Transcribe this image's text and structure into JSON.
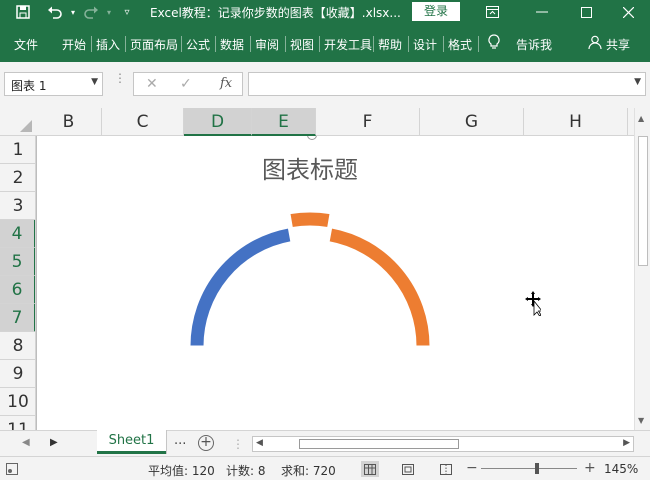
{
  "window": {
    "title": "Excel教程：记录你步数的图表【收藏】.xlsx...",
    "login_label": "登录"
  },
  "ribbon": {
    "tabs": [
      "文件",
      "开始",
      "插入",
      "页面布局",
      "公式",
      "数据",
      "审阅",
      "视图",
      "开发工具",
      "帮助",
      "设计",
      "格式"
    ],
    "tell_me": "告诉我",
    "share": "共享"
  },
  "formula_bar": {
    "name_box": "图表 1",
    "fx": "fx",
    "formula": ""
  },
  "columns": [
    "B",
    "C",
    "D",
    "E",
    "F",
    "G",
    "H"
  ],
  "selected_columns": [
    "D",
    "E"
  ],
  "rows": [
    "1",
    "2",
    "3",
    "4",
    "5",
    "6",
    "7",
    "8",
    "9",
    "10",
    "11"
  ],
  "selected_rows": [
    "4",
    "5",
    "6",
    "7"
  ],
  "chart_data": {
    "type": "pie",
    "title": "图表标题",
    "style": "half-doughnut",
    "categories": [
      "",
      "",
      ""
    ],
    "values": [
      40,
      10,
      40
    ],
    "exploded": [
      false,
      true,
      false
    ],
    "colors": [
      "#4472C4",
      "#ED7D31",
      "#ED7D31"
    ],
    "start_angle_deg": 180,
    "end_angle_deg": 360
  },
  "sheet": {
    "tab": "Sheet1",
    "more": "..."
  },
  "status": {
    "average": "平均值: 120",
    "count": "计数: 8",
    "sum": "求和: 720",
    "zoom": "145%"
  },
  "colors": {
    "accent": "#217346",
    "blue": "#4472C4",
    "orange": "#ED7D31"
  }
}
